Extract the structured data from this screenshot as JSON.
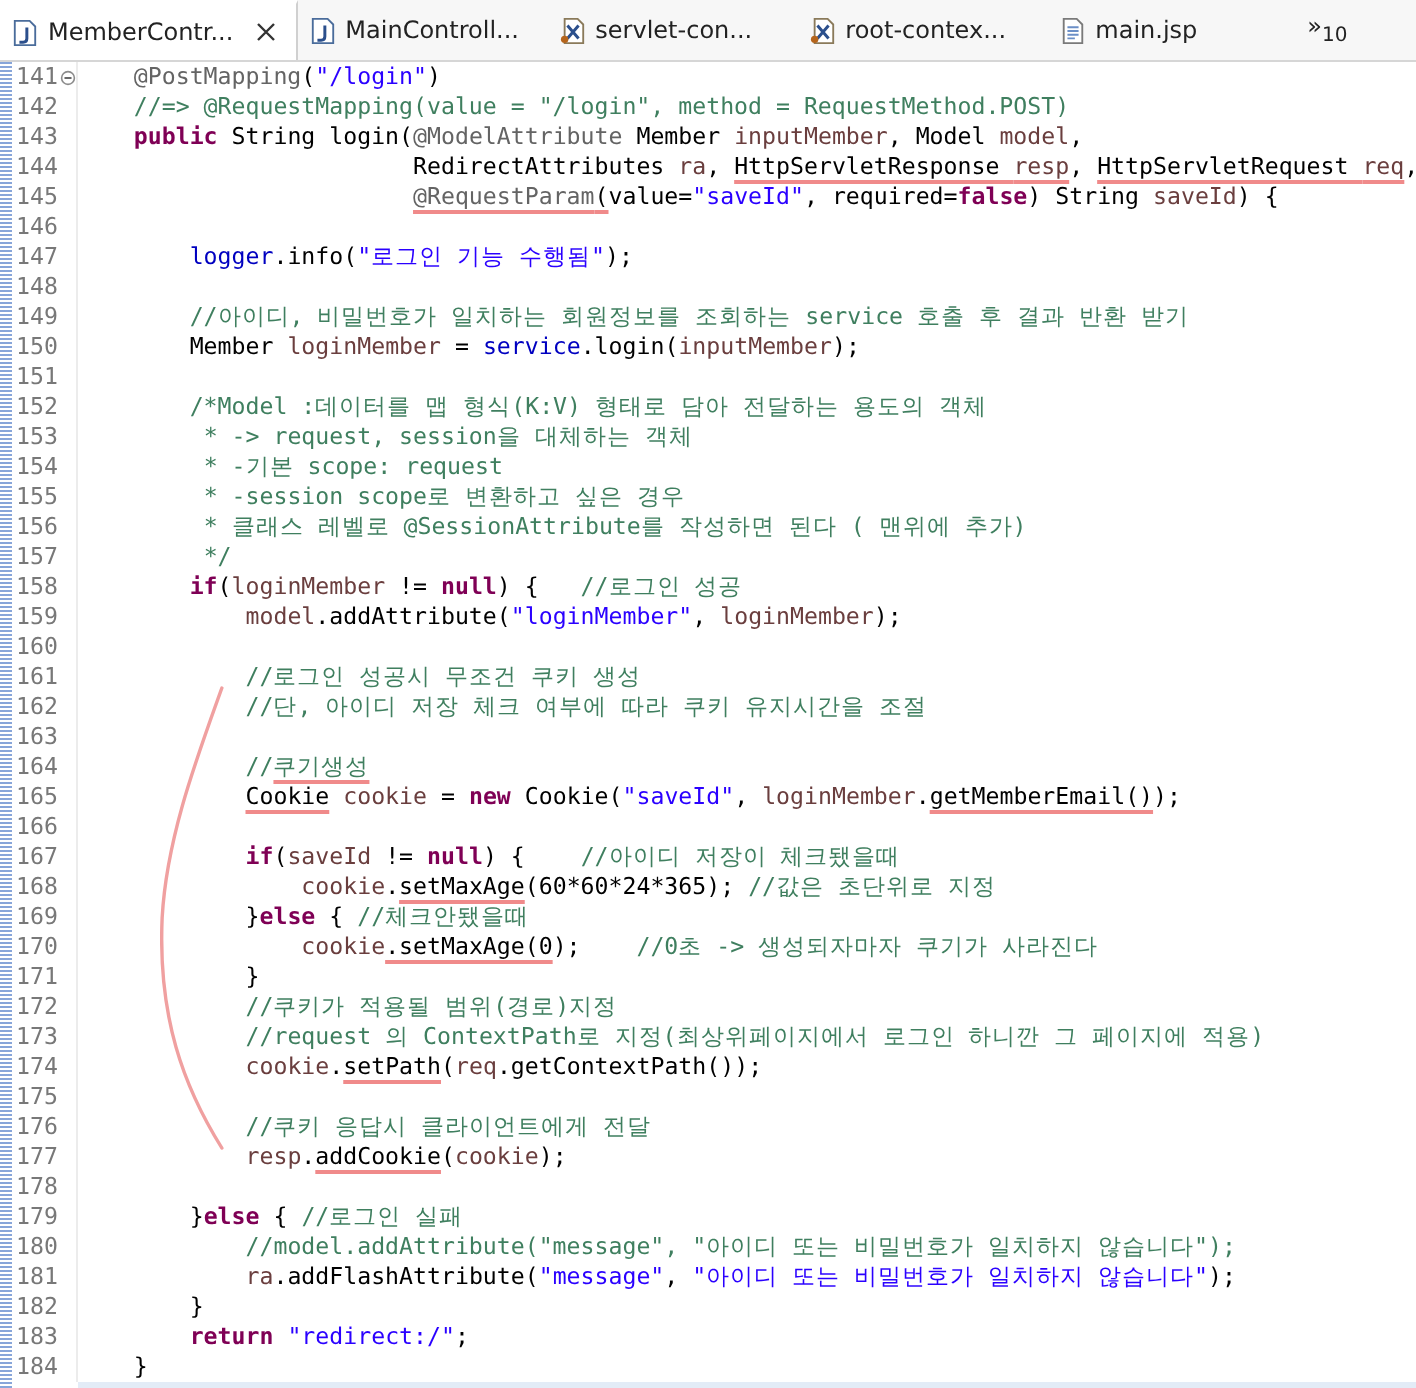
{
  "tabs": [
    {
      "label": "MemberContr...",
      "kind": "java",
      "selected": true,
      "closable": true
    },
    {
      "label": "MainControll...",
      "kind": "java",
      "selected": false,
      "closable": false
    },
    {
      "label": "servlet-con...",
      "kind": "xml",
      "selected": false,
      "closable": false
    },
    {
      "label": "root-contex...",
      "kind": "xml",
      "selected": false,
      "closable": false
    },
    {
      "label": "main.jsp",
      "kind": "jsp",
      "selected": false,
      "closable": false
    }
  ],
  "overflow": "»$_{10}$",
  "hand_marks": {
    "bracket": true
  },
  "lines": [
    {
      "number": "141",
      "folding": true,
      "segments": [
        {
          "text": "    @PostMapping",
          "kind": "annotation"
        },
        {
          "text": "(",
          "kind": "plain"
        },
        {
          "text": "\"/login\"",
          "kind": "string"
        },
        {
          "text": ")",
          "kind": "plain"
        }
      ]
    },
    {
      "number": "142",
      "segments": [
        {
          "text": "    //=> @RequestMapping(value = \"/login\", method = RequestMethod.POST)",
          "kind": "comment"
        }
      ]
    },
    {
      "number": "143",
      "segments": [
        {
          "text": "    public",
          "kind": "keyword"
        },
        {
          "text": " String login(",
          "kind": "plain"
        },
        {
          "text": "@ModelAttribute",
          "kind": "annotation"
        },
        {
          "text": " Member ",
          "kind": "plain"
        },
        {
          "text": "inputMember",
          "kind": "local"
        },
        {
          "text": ", Model ",
          "kind": "plain"
        },
        {
          "text": "model",
          "kind": "local"
        },
        {
          "text": ",",
          "kind": "plain"
        }
      ]
    },
    {
      "number": "144",
      "segments": [
        {
          "text": "                        RedirectAttributes ",
          "kind": "plain"
        },
        {
          "text": "ra",
          "kind": "local"
        },
        {
          "text": ", ",
          "kind": "plain"
        },
        {
          "text": "HttpServletResponse ",
          "kind": "plain",
          "underlined": true
        },
        {
          "text": "resp",
          "kind": "local",
          "underlined": true
        },
        {
          "text": ", ",
          "kind": "plain"
        },
        {
          "text": "HttpServletRequest ",
          "kind": "plain",
          "underlined": true
        },
        {
          "text": "req",
          "kind": "local",
          "underlined": true
        },
        {
          "text": ",",
          "kind": "plain"
        }
      ]
    },
    {
      "number": "145",
      "segments": [
        {
          "text": "                        @RequestParam",
          "kind": "annotation",
          "underlined": true
        },
        {
          "text": "(",
          "kind": "plain",
          "underlined": true
        },
        {
          "text": "value=",
          "kind": "plain"
        },
        {
          "text": "\"saveId\"",
          "kind": "string"
        },
        {
          "text": ", required=",
          "kind": "plain"
        },
        {
          "text": "false",
          "kind": "keyword"
        },
        {
          "text": ") String ",
          "kind": "plain"
        },
        {
          "text": "saveId",
          "kind": "local"
        },
        {
          "text": ") {",
          "kind": "plain"
        }
      ]
    },
    {
      "number": "146"
    },
    {
      "number": "147",
      "segments": [
        {
          "text": "        logger",
          "kind": "field"
        },
        {
          "text": ".info(",
          "kind": "plain"
        },
        {
          "text": "\"로그인 기능 수행됨\"",
          "kind": "string"
        },
        {
          "text": ");",
          "kind": "plain"
        }
      ]
    },
    {
      "number": "148"
    },
    {
      "number": "149",
      "segments": [
        {
          "text": "        //아이디, 비밀번호가 일치하는 회원정보를 조회하는 service 호출 후 결과 반환 받기",
          "kind": "comment"
        }
      ]
    },
    {
      "number": "150",
      "segments": [
        {
          "text": "        Member ",
          "kind": "plain"
        },
        {
          "text": "loginMember",
          "kind": "local"
        },
        {
          "text": " = ",
          "kind": "plain"
        },
        {
          "text": "service",
          "kind": "field"
        },
        {
          "text": ".login(",
          "kind": "plain"
        },
        {
          "text": "inputMember",
          "kind": "local"
        },
        {
          "text": ");",
          "kind": "plain"
        }
      ]
    },
    {
      "number": "151"
    },
    {
      "number": "152",
      "segments": [
        {
          "text": "        /*Model :데이터를 맵 형식(K:V) 형태로 담아 전달하는 용도의 객체",
          "kind": "comment"
        }
      ]
    },
    {
      "number": "153",
      "segments": [
        {
          "text": "         * -> request, session을 대체하는 객체",
          "kind": "comment"
        }
      ]
    },
    {
      "number": "154",
      "segments": [
        {
          "text": "         * -기본 scope: request",
          "kind": "comment"
        }
      ]
    },
    {
      "number": "155",
      "segments": [
        {
          "text": "         * -session scope로 변환하고 싶은 경우",
          "kind": "comment"
        }
      ]
    },
    {
      "number": "156",
      "segments": [
        {
          "text": "         * 클래스 레벨로 @SessionAttribute를 작성하면 된다 ( 맨위에 추가)",
          "kind": "comment"
        }
      ]
    },
    {
      "number": "157",
      "segments": [
        {
          "text": "         */",
          "kind": "comment"
        }
      ]
    },
    {
      "number": "158",
      "segments": [
        {
          "text": "        if",
          "kind": "keyword"
        },
        {
          "text": "(",
          "kind": "plain"
        },
        {
          "text": "loginMember",
          "kind": "local"
        },
        {
          "text": " != ",
          "kind": "plain"
        },
        {
          "text": "null",
          "kind": "keyword"
        },
        {
          "text": ") {   ",
          "kind": "plain"
        },
        {
          "text": "//로그인 성공",
          "kind": "comment"
        }
      ]
    },
    {
      "number": "159",
      "segments": [
        {
          "text": "            model",
          "kind": "local"
        },
        {
          "text": ".addAttribute(",
          "kind": "plain"
        },
        {
          "text": "\"loginMember\"",
          "kind": "string"
        },
        {
          "text": ", ",
          "kind": "plain"
        },
        {
          "text": "loginMember",
          "kind": "local"
        },
        {
          "text": ");",
          "kind": "plain"
        }
      ]
    },
    {
      "number": "160"
    },
    {
      "number": "161",
      "segments": [
        {
          "text": "            //로그인 성공시 무조건 쿠키 생성",
          "kind": "comment"
        }
      ]
    },
    {
      "number": "162",
      "segments": [
        {
          "text": "            //단, 아이디 저장 체크 여부에 따라 쿠키 유지시간을 조절",
          "kind": "comment"
        }
      ]
    },
    {
      "number": "163"
    },
    {
      "number": "164",
      "segments": [
        {
          "text": "            //",
          "kind": "comment"
        },
        {
          "text": "쿠기생성",
          "kind": "comment",
          "underlined": true
        }
      ]
    },
    {
      "number": "165",
      "segments": [
        {
          "text": "            Cookie",
          "kind": "plain",
          "underlined": true
        },
        {
          "text": " cookie",
          "kind": "local"
        },
        {
          "text": " = ",
          "kind": "plain"
        },
        {
          "text": "new",
          "kind": "keyword"
        },
        {
          "text": " Cookie(",
          "kind": "plain"
        },
        {
          "text": "\"saveId\"",
          "kind": "string"
        },
        {
          "text": ", ",
          "kind": "plain"
        },
        {
          "text": "loginMember",
          "kind": "local"
        },
        {
          "text": ".",
          "kind": "plain"
        },
        {
          "text": "getMemberEmail()",
          "kind": "plain",
          "underlined": true
        },
        {
          "text": ");",
          "kind": "plain"
        }
      ]
    },
    {
      "number": "166"
    },
    {
      "number": "167",
      "segments": [
        {
          "text": "            if",
          "kind": "keyword"
        },
        {
          "text": "(",
          "kind": "plain"
        },
        {
          "text": "saveId",
          "kind": "local"
        },
        {
          "text": " != ",
          "kind": "plain"
        },
        {
          "text": "null",
          "kind": "keyword"
        },
        {
          "text": ") {    ",
          "kind": "plain"
        },
        {
          "text": "//아이디 저장이 체크됐을때",
          "kind": "comment"
        }
      ]
    },
    {
      "number": "168",
      "segments": [
        {
          "text": "                cookie",
          "kind": "local"
        },
        {
          "text": ".",
          "kind": "plain"
        },
        {
          "text": "setMaxAge",
          "kind": "plain",
          "underlined": true
        },
        {
          "text": "(60*60*24*365); ",
          "kind": "plain"
        },
        {
          "text": "//값은 초단위로 지정",
          "kind": "comment"
        }
      ]
    },
    {
      "number": "169",
      "segments": [
        {
          "text": "            }",
          "kind": "plain"
        },
        {
          "text": "else",
          "kind": "keyword"
        },
        {
          "text": " { ",
          "kind": "plain"
        },
        {
          "text": "//체크안됐을때",
          "kind": "comment"
        }
      ]
    },
    {
      "number": "170",
      "segments": [
        {
          "text": "                cookie",
          "kind": "local"
        },
        {
          "text": ".setMaxAge(0",
          "kind": "plain",
          "underlined": true
        },
        {
          "text": ");    ",
          "kind": "plain"
        },
        {
          "text": "//0초 -> 생성되자마자 쿠기가 사라진다",
          "kind": "comment"
        }
      ]
    },
    {
      "number": "171",
      "segments": [
        {
          "text": "            }",
          "kind": "plain"
        }
      ]
    },
    {
      "number": "172",
      "segments": [
        {
          "text": "            //쿠키가 적용될 범위(경로)지정",
          "kind": "comment"
        }
      ]
    },
    {
      "number": "173",
      "segments": [
        {
          "text": "            //request 의 ContextPath로 지정(최상위페이지에서 로그인 하니깐 그 페이지에 적용)",
          "kind": "comment"
        }
      ]
    },
    {
      "number": "174",
      "segments": [
        {
          "text": "            cookie",
          "kind": "local"
        },
        {
          "text": ".",
          "kind": "plain"
        },
        {
          "text": "setPath",
          "kind": "plain",
          "underlined": true
        },
        {
          "text": "(",
          "kind": "plain"
        },
        {
          "text": "req",
          "kind": "local"
        },
        {
          "text": ".getContextPath());",
          "kind": "plain"
        }
      ]
    },
    {
      "number": "175"
    },
    {
      "number": "176",
      "segments": [
        {
          "text": "            //쿠키 응답시 클라이언트에게 전달",
          "kind": "comment"
        }
      ]
    },
    {
      "number": "177",
      "segments": [
        {
          "text": "            resp",
          "kind": "local"
        },
        {
          "text": ".",
          "kind": "plain"
        },
        {
          "text": "addCookie",
          "kind": "plain",
          "underlined": true
        },
        {
          "text": "(",
          "kind": "plain"
        },
        {
          "text": "cookie",
          "kind": "local"
        },
        {
          "text": ");",
          "kind": "plain"
        }
      ]
    },
    {
      "number": "178"
    },
    {
      "number": "179",
      "segments": [
        {
          "text": "        }",
          "kind": "plain"
        },
        {
          "text": "else",
          "kind": "keyword"
        },
        {
          "text": " { ",
          "kind": "plain"
        },
        {
          "text": "//로그인 실패",
          "kind": "comment"
        }
      ]
    },
    {
      "number": "180",
      "segments": [
        {
          "text": "            //model.addAttribute(\"message\", \"아이디 또는 비밀번호가 일치하지 않습니다\");",
          "kind": "comment"
        }
      ]
    },
    {
      "number": "181",
      "segments": [
        {
          "text": "            ra",
          "kind": "local"
        },
        {
          "text": ".addFlashAttribute(",
          "kind": "plain"
        },
        {
          "text": "\"message\"",
          "kind": "string"
        },
        {
          "text": ", ",
          "kind": "plain"
        },
        {
          "text": "\"아이디 또는 비밀번호가 일치하지 않습니다\"",
          "kind": "string"
        },
        {
          "text": ");",
          "kind": "plain"
        }
      ]
    },
    {
      "number": "182",
      "segments": [
        {
          "text": "        }",
          "kind": "plain"
        }
      ]
    },
    {
      "number": "183",
      "segments": [
        {
          "text": "        return ",
          "kind": "keyword"
        },
        {
          "text": "\"redirect:/\"",
          "kind": "string"
        },
        {
          "text": ";",
          "kind": "plain"
        }
      ]
    },
    {
      "number": "184",
      "segments": [
        {
          "text": "    }",
          "kind": "plain"
        }
      ]
    }
  ]
}
